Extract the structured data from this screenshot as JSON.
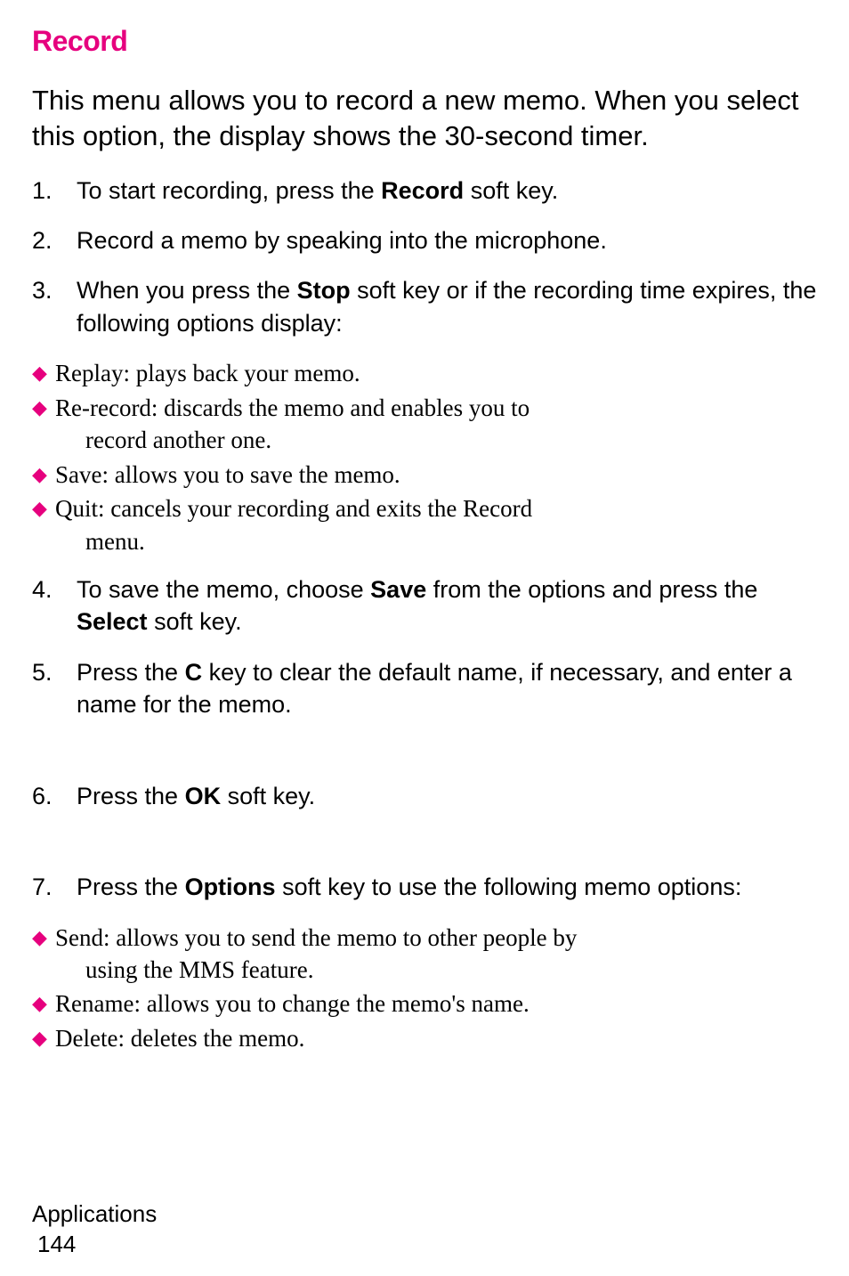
{
  "heading": "Record",
  "intro": "This menu allows you to record a new memo. When you select this option, the display shows the 30-second timer.",
  "steps": {
    "s1": {
      "num": "1.",
      "pre": "To start recording, press the ",
      "bold": "Record",
      "post": " soft key."
    },
    "s2": {
      "num": "2.",
      "text": "Record a memo by speaking into the microphone."
    },
    "s3": {
      "num": "3.",
      "pre": "When you press the ",
      "bold": "Stop",
      "post": " soft key or if the recording time expires, the following options display:"
    },
    "s4": {
      "num": "4.",
      "pre": "To save the memo, choose ",
      "bold1": "Save",
      "mid": " from the options and press the ",
      "bold2": "Select",
      "post": " soft key."
    },
    "s5": {
      "num": "5.",
      "pre": "Press the ",
      "bold": "C",
      "post": " key to clear the default name, if necessary, and enter a name for the memo."
    },
    "s6": {
      "num": "6.",
      "pre": "Press the ",
      "bold": "OK",
      "post": " soft key."
    },
    "s7": {
      "num": "7.",
      "pre": "Press the ",
      "bold": "Options",
      "post": " soft key to use the following memo options:"
    }
  },
  "bullets_a": {
    "b1": "Replay: plays back your memo.",
    "b2_l1": "Re-record: discards the memo and enables you to",
    "b2_l2": "record another one.",
    "b3": "Save: allows you to save the memo.",
    "b4_l1": "Quit: cancels your recording and exits the Record",
    "b4_l2": "menu."
  },
  "bullets_b": {
    "b1_l1": "Send: allows you to send the memo to other people by",
    "b1_l2": "using the MMS feature.",
    "b2": "Rename: allows you to change the memo's name.",
    "b3": "Delete: deletes the memo."
  },
  "footer": {
    "section": "Applications",
    "page": "144"
  }
}
